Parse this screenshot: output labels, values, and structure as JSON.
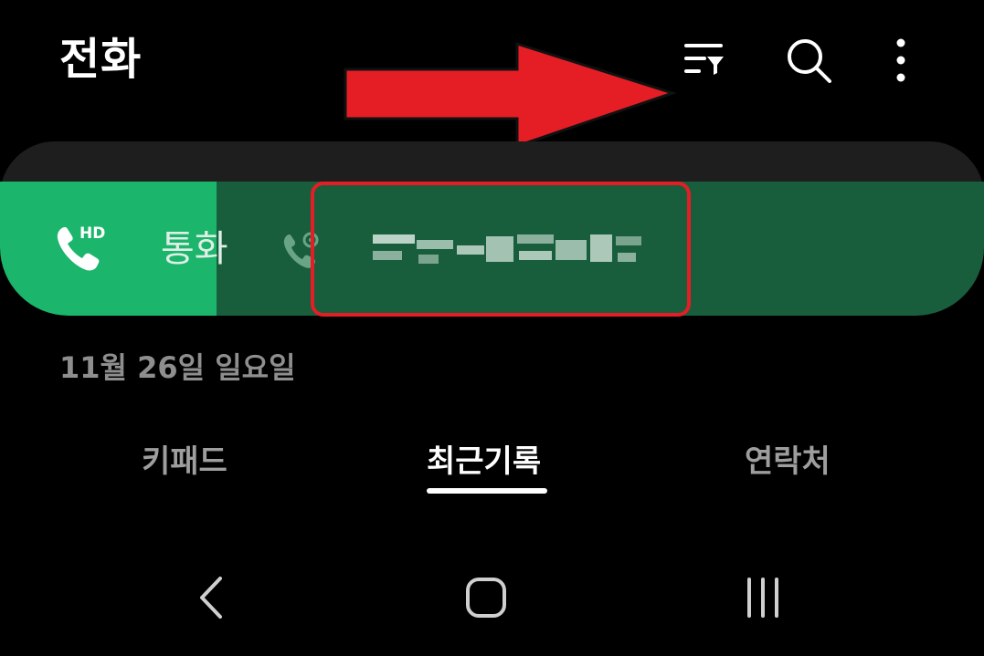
{
  "header": {
    "title": "전화",
    "icons": [
      "filter-icon",
      "search-icon",
      "more-vertical-icon"
    ]
  },
  "call_banner": {
    "hd_badge": "HD",
    "status_label": "통화",
    "number_display": "obscured",
    "progress": 0.22,
    "colors": {
      "background": "#195e3c",
      "progress": "#1bb56b"
    }
  },
  "date": "11월 26일 일요일",
  "tabs": [
    {
      "label": "키패드",
      "selected": false
    },
    {
      "label": "최근기록",
      "selected": true
    },
    {
      "label": "연락처",
      "selected": false
    }
  ],
  "navigation": {
    "icons": [
      "back-icon",
      "home-icon",
      "recent-apps-icon"
    ]
  },
  "annotations": {
    "arrow_color": "#e51d25",
    "box_color": "#e51d25"
  }
}
